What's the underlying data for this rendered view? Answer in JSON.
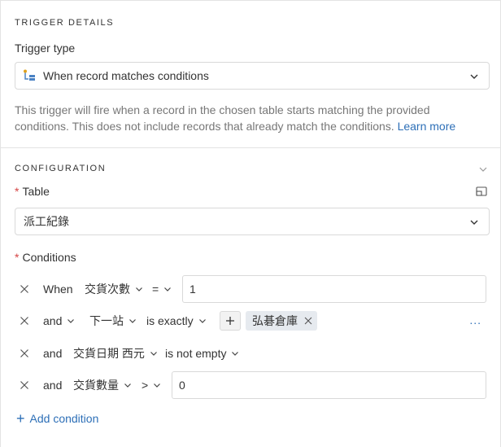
{
  "trigger_details": {
    "section_title": "TRIGGER DETAILS",
    "trigger_type_label": "Trigger type",
    "trigger_type_value": "When record matches conditions",
    "description": "This trigger will fire when a record in the chosen table starts matching the provided conditions. This does not include records that already match the conditions.",
    "learn_more": "Learn more"
  },
  "configuration": {
    "section_title": "CONFIGURATION",
    "table_label": "Table",
    "table_value": "派工紀錄",
    "conditions_label": "Conditions",
    "conditions": [
      {
        "conjunction": "When",
        "field": "交貨次數",
        "operator": "=",
        "value": "1"
      },
      {
        "conjunction": "and",
        "field": "下一站",
        "operator": "is exactly",
        "value": "弘碁倉庫"
      },
      {
        "conjunction": "and",
        "field": "交貨日期 西元",
        "operator": "is not empty",
        "value": ""
      },
      {
        "conjunction": "and",
        "field": "交貨數量",
        "operator": ">",
        "value": "0"
      }
    ],
    "more_label": "...",
    "add_condition": "Add condition"
  },
  "colors": {
    "accent": "#2d6fb7",
    "required": "#d54444",
    "muted_text": "#777777",
    "border": "#d9d9d9"
  },
  "icons": [
    "trigger-type-icon",
    "chevron-down-icon",
    "expand-icon",
    "close-icon",
    "plus-icon"
  ]
}
